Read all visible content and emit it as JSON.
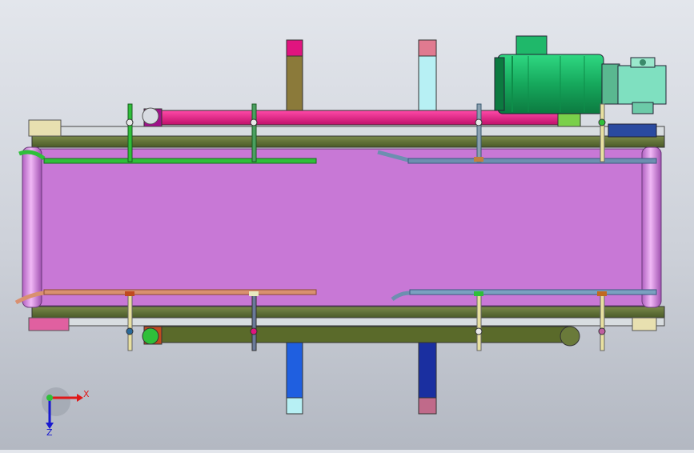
{
  "view": {
    "axis_x_label": "X",
    "axis_z_label": "Z"
  },
  "colors": {
    "belt": "#c878d6",
    "frame": "#556b2f",
    "motor": "#1fb86a",
    "gearbox": "#7fe0c0",
    "upper_rail": "#e0147f",
    "guide_green": "#2fbf3a",
    "guide_blue": "#6d8fb0",
    "guide_orange": "#d99070",
    "roller": "#d58ce0",
    "leg_magenta": "#e0147f",
    "leg_cyan": "#b7f0f4",
    "leg_blue": "#1f5fe0",
    "leg_navy": "#1a2fa0"
  },
  "icons": {
    "triad": "axis-triad-icon"
  }
}
